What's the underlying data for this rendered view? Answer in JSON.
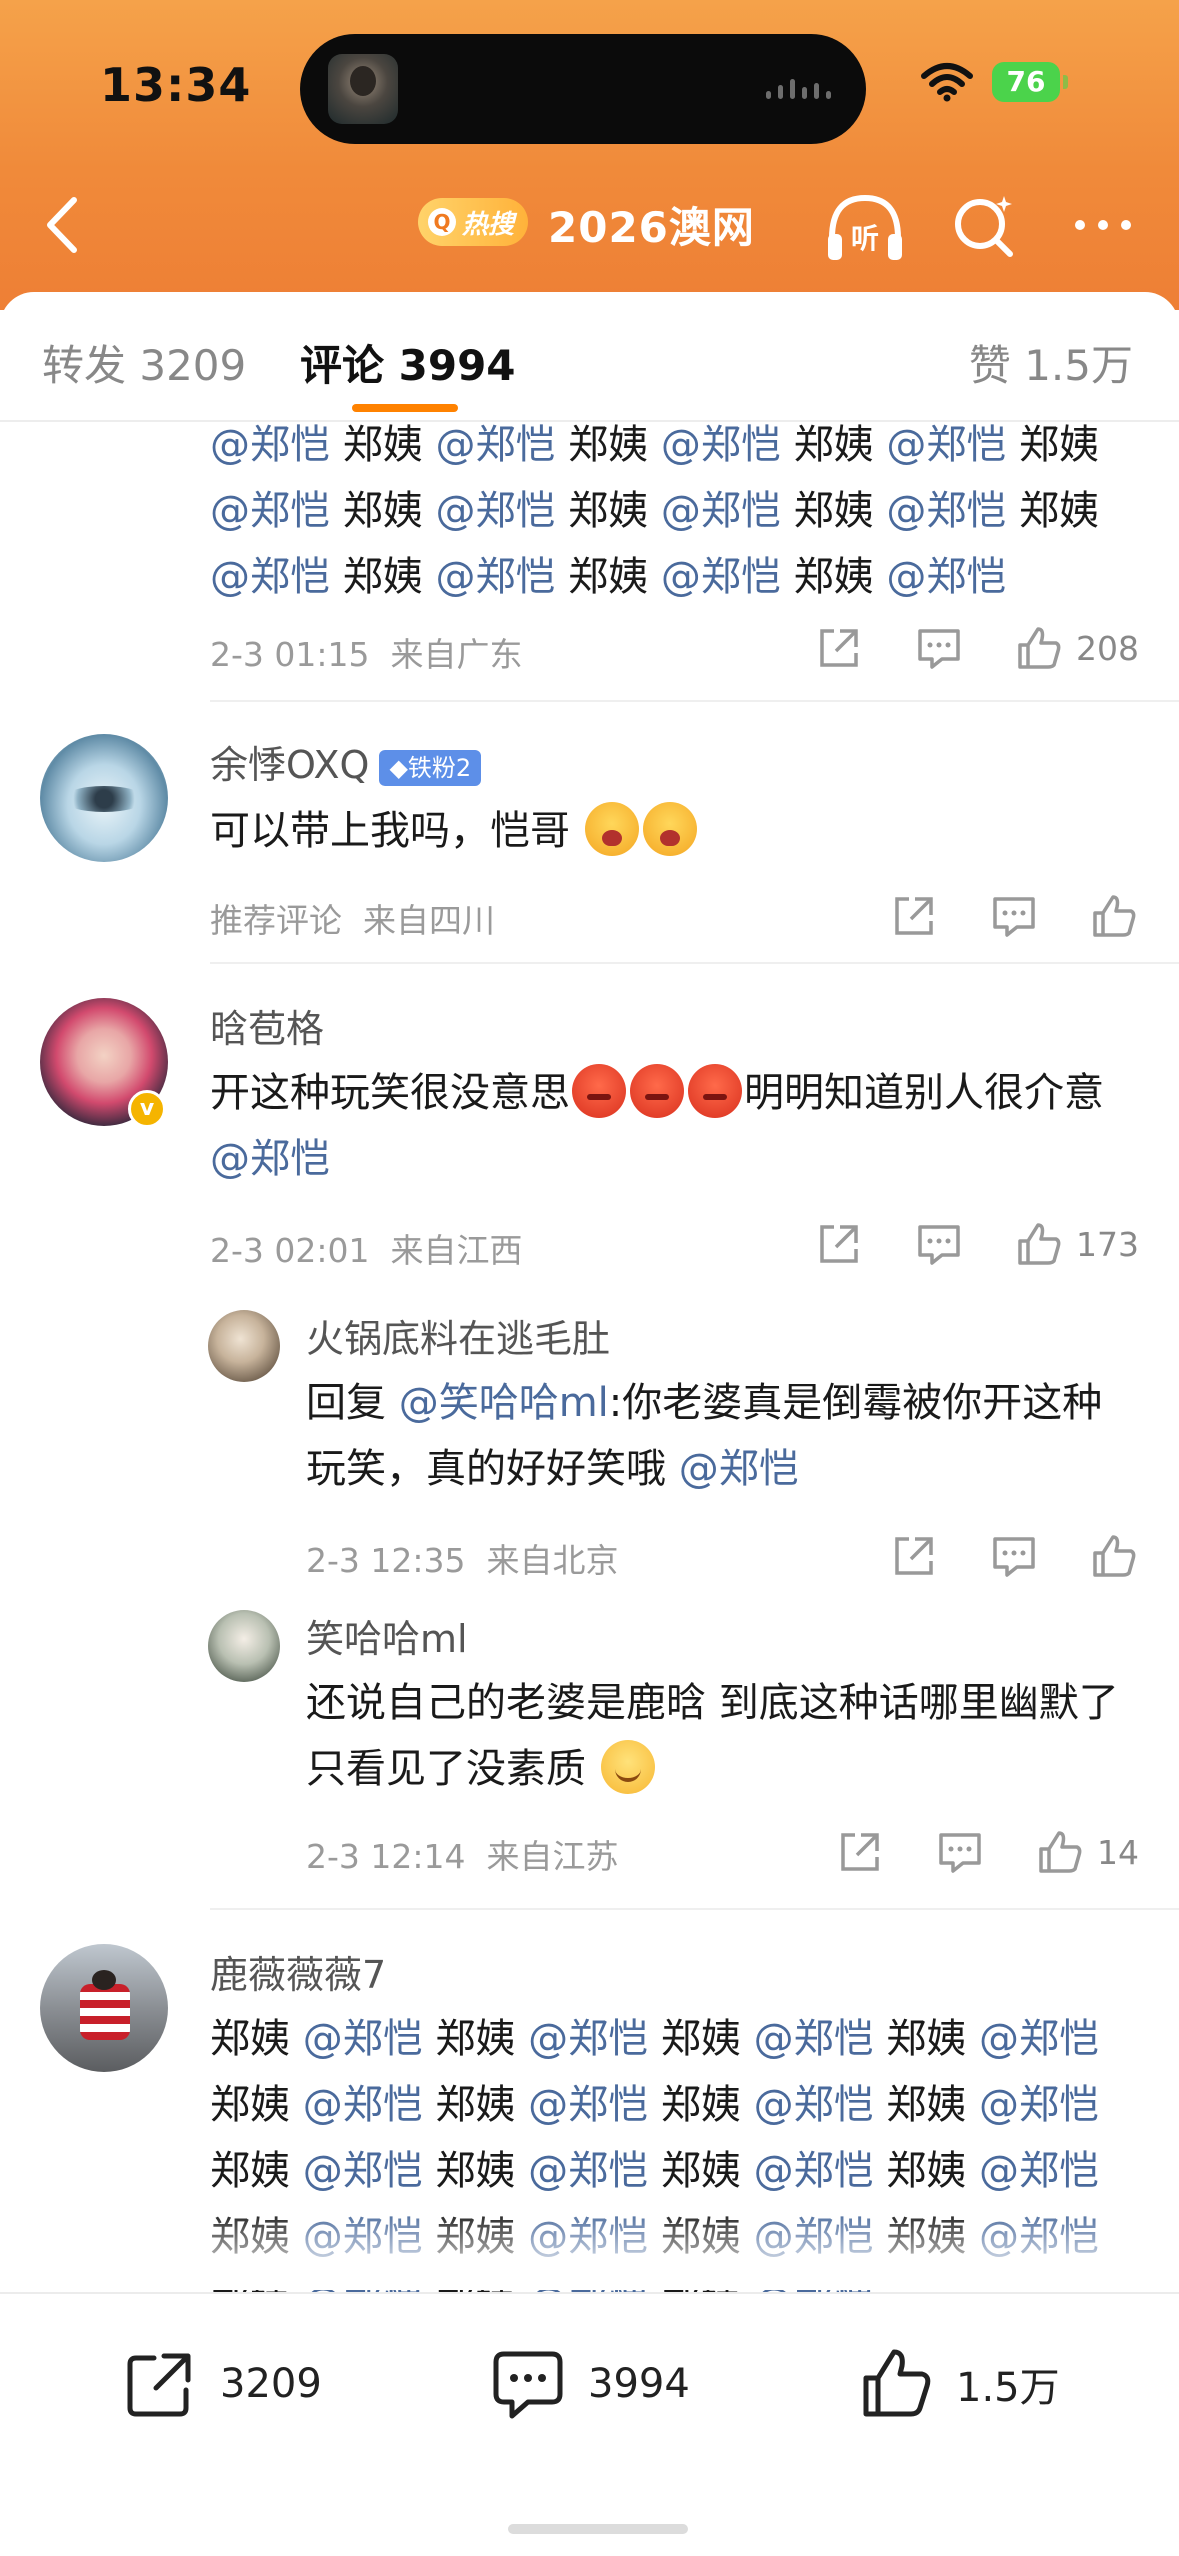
{
  "status_bar": {
    "time": "13:34",
    "battery": "76"
  },
  "nav": {
    "hot_label": "热搜",
    "title": "2026澳网"
  },
  "tabs": {
    "repost": "转发 3209",
    "comment": "评论 3994",
    "likes": "赞 1.5万"
  },
  "comments": [
    {
      "id": "c0",
      "segments": [
        {
          "t": "@郑恺",
          "at": true
        },
        {
          "t": " 郑姨 "
        },
        {
          "t": "@郑恺",
          "at": true
        },
        {
          "t": " 郑姨 "
        },
        {
          "t": "@郑恺",
          "at": true
        },
        {
          "t": " 郑姨 "
        },
        {
          "t": "@郑恺",
          "at": true
        },
        {
          "t": " 郑姨 "
        },
        {
          "t": "@郑恺",
          "at": true
        },
        {
          "t": " 郑姨 "
        },
        {
          "t": "@郑恺",
          "at": true
        },
        {
          "t": " 郑姨 "
        },
        {
          "t": "@郑恺",
          "at": true
        },
        {
          "t": " 郑姨 "
        },
        {
          "t": "@郑恺",
          "at": true
        },
        {
          "t": " 郑姨 "
        },
        {
          "t": "@郑恺",
          "at": true
        },
        {
          "t": " 郑姨 "
        },
        {
          "t": "@郑恺",
          "at": true
        },
        {
          "t": " 郑姨 "
        },
        {
          "t": "@郑恺",
          "at": true
        },
        {
          "t": " 郑姨 "
        },
        {
          "t": "@郑恺",
          "at": true
        }
      ],
      "time": "2-3 01:15",
      "location": "来自广东",
      "likes": "208"
    },
    {
      "id": "c1",
      "username": "余悸OXQ",
      "badge": "铁粉2",
      "text": "可以带上我吗，恺哥",
      "meta_tag": "推荐评论",
      "location": "来自四川",
      "likes": ""
    },
    {
      "id": "c2",
      "username": "晗苞格",
      "text_a": "开这种玩笑很没意思",
      "text_b": "明明知道别人很介意",
      "mention": "@郑恺",
      "time": "2-3 02:01",
      "location": "来自江西",
      "likes": "173"
    },
    {
      "id": "r1",
      "username": "火锅底料在逃毛肚",
      "reply_prefix": "回复",
      "reply_to": "@笑哈哈ml",
      "text": ":你老婆真是倒霉被你开这种玩笑，真的好好笑哦",
      "mention": "@郑恺",
      "time": "2-3 12:35",
      "location": "来自北京",
      "likes": ""
    },
    {
      "id": "r2",
      "username": "笑哈哈ml",
      "text": "还说自己的老婆是鹿晗 到底这种话哪里幽默了 只看见了没素质",
      "time": "2-3 12:14",
      "location": "来自江苏",
      "likes": "14"
    },
    {
      "id": "c3",
      "username": "鹿薇薇薇7",
      "segments": [
        {
          "t": "郑姨 "
        },
        {
          "t": "@郑恺",
          "at": true
        },
        {
          "t": " 郑姨 "
        },
        {
          "t": "@郑恺",
          "at": true
        },
        {
          "t": " 郑姨 "
        },
        {
          "t": "@郑恺",
          "at": true
        },
        {
          "t": " 郑姨 "
        },
        {
          "t": "@郑恺",
          "at": true
        },
        {
          "t": " 郑姨 "
        },
        {
          "t": "@郑恺",
          "at": true
        },
        {
          "t": " 郑姨 "
        },
        {
          "t": "@郑恺",
          "at": true
        },
        {
          "t": " 郑姨 "
        },
        {
          "t": "@郑恺",
          "at": true
        },
        {
          "t": " 郑姨 "
        },
        {
          "t": "@郑恺",
          "at": true
        },
        {
          "t": " 郑姨 "
        },
        {
          "t": "@郑恺",
          "at": true
        },
        {
          "t": " 郑姨 "
        },
        {
          "t": "@郑恺",
          "at": true
        },
        {
          "t": " 郑姨 "
        },
        {
          "t": "@郑恺",
          "at": true
        },
        {
          "t": " 郑姨 "
        },
        {
          "t": "@郑恺",
          "at": true
        },
        {
          "t": " 郑姨 "
        },
        {
          "t": "@郑恺",
          "at": true
        },
        {
          "t": " 郑姨 "
        },
        {
          "t": "@郑恺",
          "at": true
        },
        {
          "t": " 郑姨 "
        },
        {
          "t": "@郑恺",
          "at": true
        },
        {
          "t": " 郑"
        },
        {
          "t": "姨 "
        },
        {
          "t": "@郑恺",
          "at": true
        },
        {
          "t": " 郑姨 "
        },
        {
          "t": "@郑恺",
          "at": true
        },
        {
          "t": " 郑姨 "
        },
        {
          "t": "@郑恺",
          "at": true
        },
        {
          "t": " 郑姨 "
        },
        {
          "t": "@郑恺",
          "at": true
        }
      ]
    }
  ],
  "bottom_bar": {
    "repost_count": "3209",
    "comment_count": "3994",
    "like_count": "1.5万"
  },
  "colors": {
    "accent": "#ff8200",
    "mention": "#4a6a9c",
    "header": "#f08a3a"
  },
  "icons": [
    "back-icon",
    "listen-icon",
    "search-icon",
    "more-icon",
    "share-icon",
    "comment-icon",
    "like-icon"
  ]
}
